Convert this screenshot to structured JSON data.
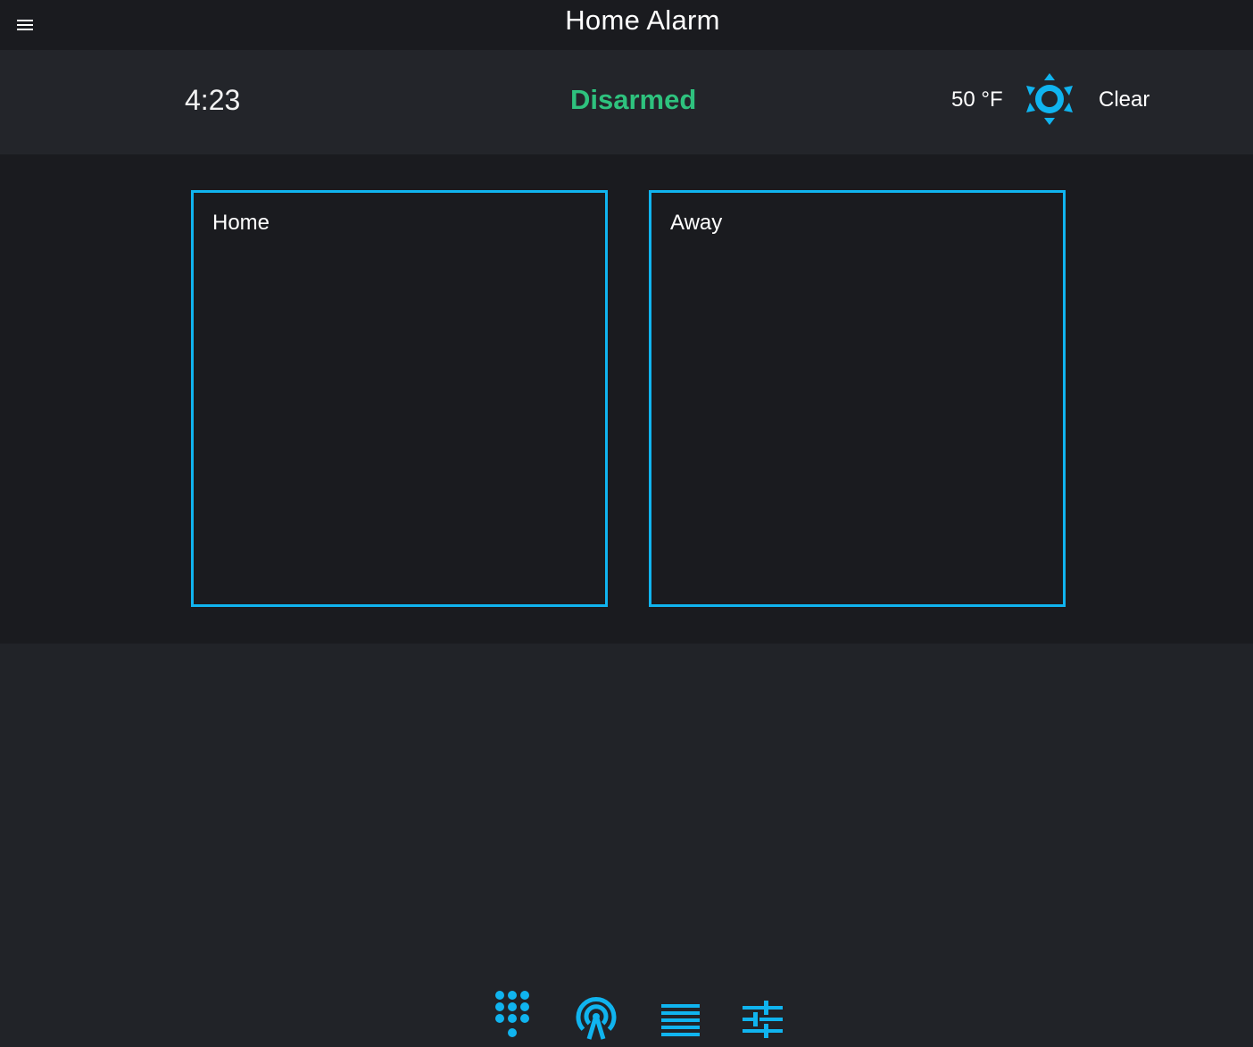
{
  "app": {
    "title": "Home Alarm"
  },
  "status": {
    "clock": "4:23",
    "arm_state": "Disarmed",
    "temperature": "50 °F",
    "weather_condition": "Clear",
    "weather_icon": "sun-icon"
  },
  "modes": [
    {
      "label": "Home"
    },
    {
      "label": "Away"
    }
  ],
  "bottom_nav": {
    "items": [
      {
        "icon": "keypad-icon"
      },
      {
        "icon": "sensors-icon"
      },
      {
        "icon": "event-log-icon"
      },
      {
        "icon": "settings-sliders-icon"
      }
    ]
  },
  "colors": {
    "accent": "#10b4ef",
    "disarmed": "#2ec27e",
    "top_bar": "#1a1b1f",
    "status_bar": "#23252a",
    "background": "#212328"
  }
}
